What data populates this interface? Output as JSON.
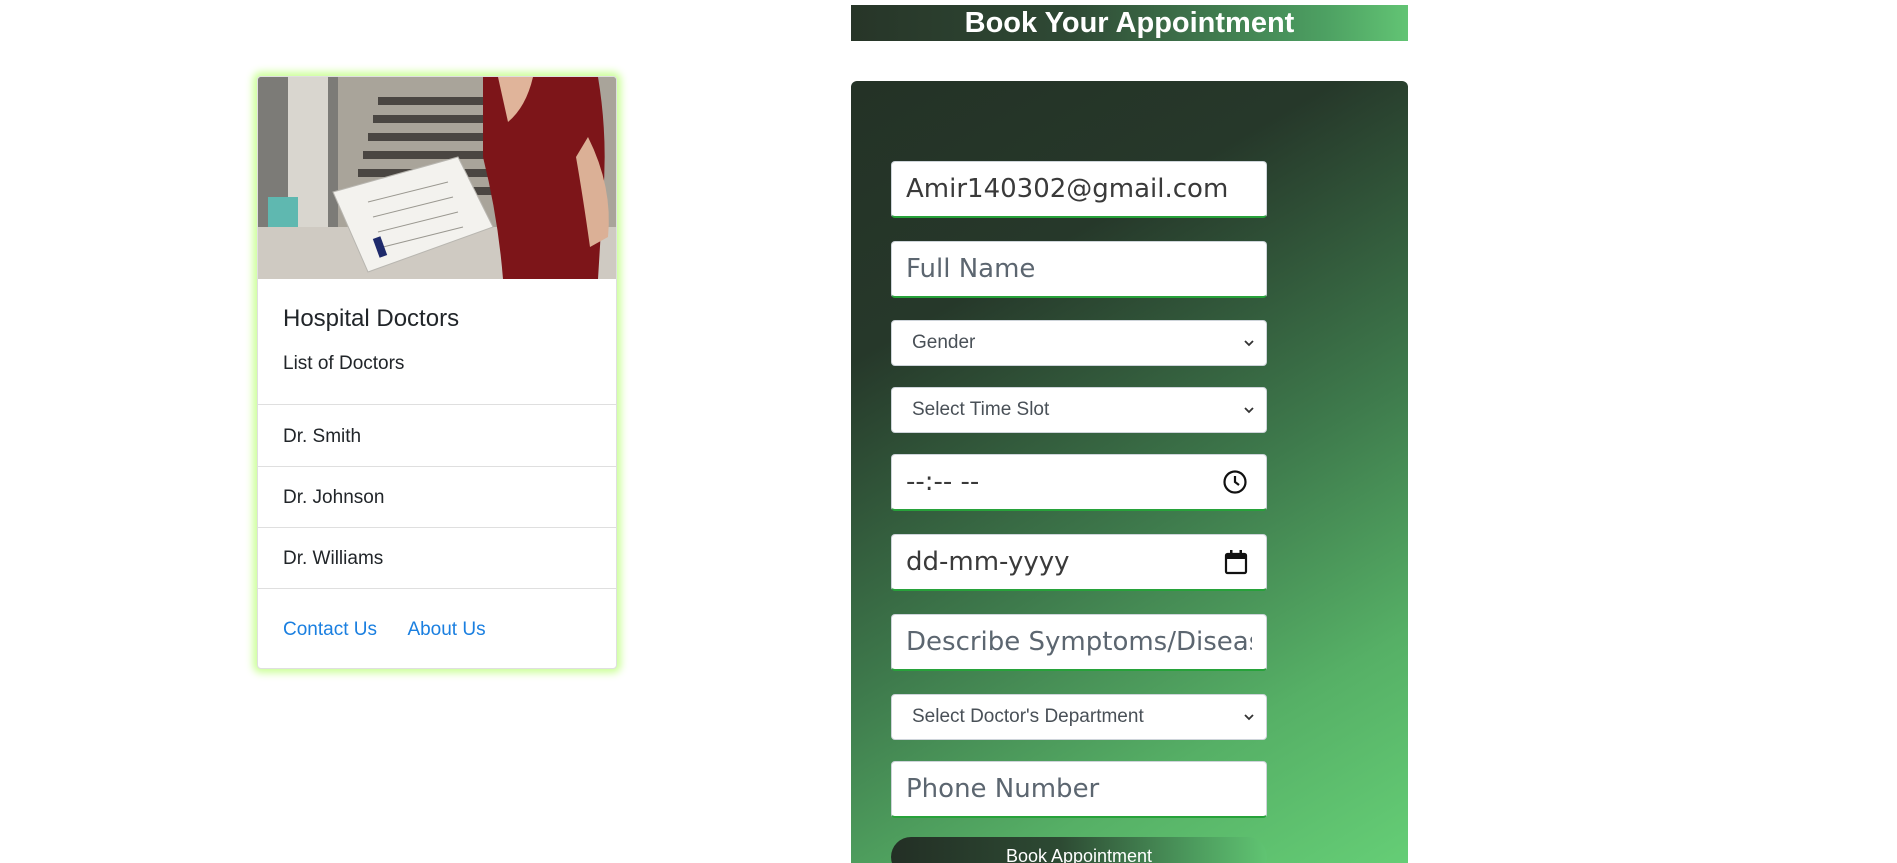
{
  "card": {
    "title": "Hospital Doctors",
    "subtitle": "List of Doctors",
    "doctors": [
      "Dr. Smith",
      "Dr. Johnson",
      "Dr. Williams"
    ],
    "links": {
      "contact": "Contact Us",
      "about": "About Us"
    }
  },
  "form": {
    "heading": "Book Your Appointment",
    "email_value": "Amir140302@gmail.com",
    "full_name_placeholder": "Full Name",
    "gender_select": "Gender",
    "time_slot_select": "Select Time Slot",
    "time_value": "--:-- --",
    "date_value": "dd-mm-yyyy",
    "symptoms_placeholder": "Describe Symptoms/Disease",
    "department_select": "Select Doctor's Department",
    "phone_placeholder": "Phone Number",
    "submit_label": "Book Appointment"
  },
  "colors": {
    "card_glow": "#ccff99",
    "link": "#1a7fe0",
    "field_underline": "#27a23a",
    "gradient_dark": "#243226",
    "gradient_light": "#66d077"
  }
}
